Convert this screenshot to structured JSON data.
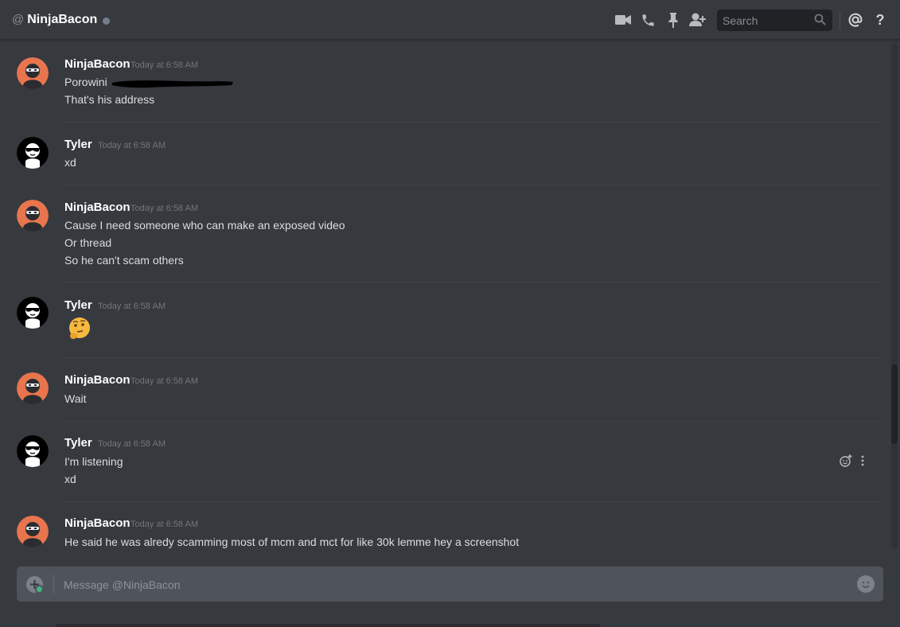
{
  "header": {
    "at_symbol": "@",
    "channel_name": "NinjaBacon",
    "search_placeholder": "Search",
    "help_label": "?"
  },
  "messages": [
    {
      "author": "NinjaBacon",
      "timestamp": "Today at 6:58 AM",
      "avatar": "ninja",
      "lines": [
        "Porowini",
        "That's his address"
      ],
      "redacted": true
    },
    {
      "author": "Tyler",
      "timestamp": "Today at 6:58 AM",
      "avatar": "sunglasses",
      "lines": [
        "xd"
      ]
    },
    {
      "author": "NinjaBacon",
      "timestamp": "Today at 6:58 AM",
      "avatar": "ninja",
      "lines": [
        "Cause I need someone who can make an exposed video",
        "Or thread",
        "So he can't scam others"
      ]
    },
    {
      "author": "Tyler",
      "timestamp": "Today at 6:58 AM",
      "avatar": "sunglasses",
      "emoji": "thinking-face"
    },
    {
      "author": "NinjaBacon",
      "timestamp": "Today at 6:58 AM",
      "avatar": "ninja",
      "lines": [
        "Wait"
      ]
    },
    {
      "author": "Tyler",
      "timestamp": "Today at 6:58 AM",
      "avatar": "sunglasses",
      "lines": [
        "I'm listening",
        "xd"
      ]
    },
    {
      "author": "NinjaBacon",
      "timestamp": "Today at 6:58 AM",
      "avatar": "ninja",
      "lines": [
        "He said he was alredy scamming most of mcm and mct for like 30k lemme hey a screenshot"
      ]
    }
  ],
  "composer": {
    "placeholder": "Message @NinjaBacon"
  },
  "icons": [
    "video-call-icon",
    "voice-call-icon",
    "pin-icon",
    "add-friend-icon",
    "search-icon",
    "mention-icon",
    "help-icon",
    "add-reaction-icon",
    "more-options-icon",
    "upload-icon",
    "emoji-picker-icon"
  ],
  "colors": {
    "background": "#36393e",
    "text": "#dcddde",
    "muted": "#72767d",
    "ninja_avatar": "#e8754e"
  }
}
